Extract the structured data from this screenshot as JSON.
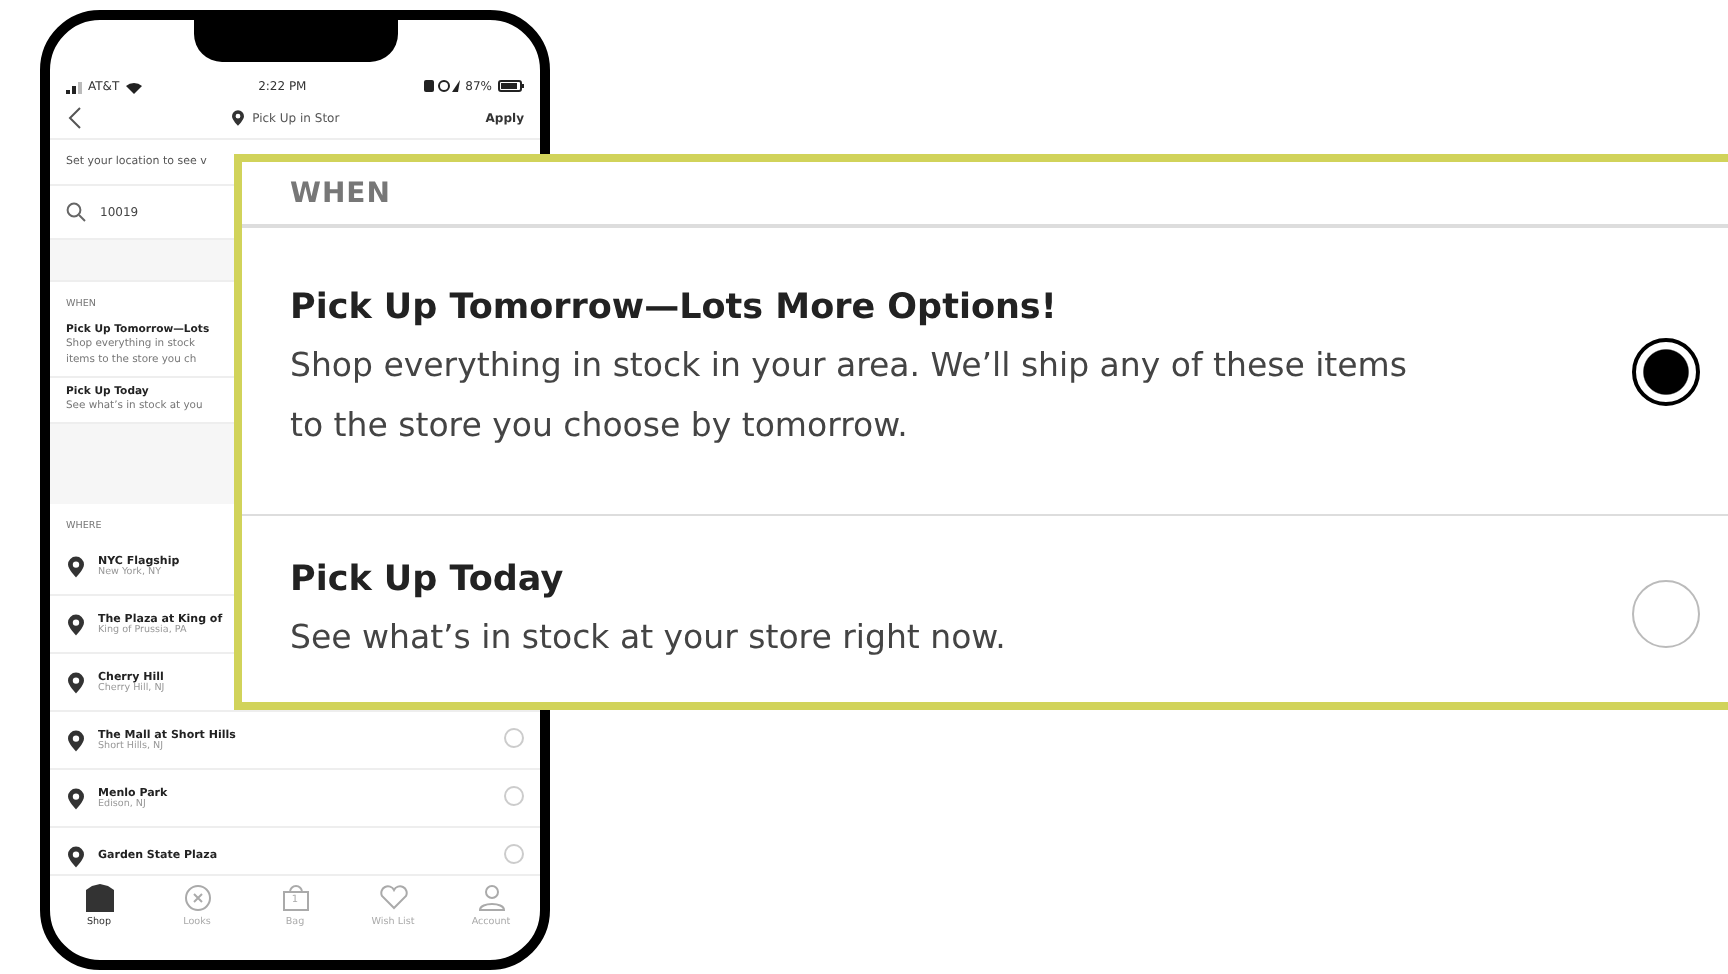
{
  "status_bar": {
    "carrier": "AT&T",
    "time": "2:22 PM",
    "battery": "87%"
  },
  "nav": {
    "title": "Pick Up in Stor",
    "action": "Apply"
  },
  "location_hint": "Set your location to see v",
  "search": {
    "value": "10019"
  },
  "when": {
    "heading": "WHEN",
    "options": [
      {
        "title": "Pick Up Tomorrow—Lots",
        "lines": [
          "Shop everything in stock",
          "items to the store you ch"
        ]
      },
      {
        "title": "Pick Up Today",
        "lines": [
          "See what’s in stock at you"
        ]
      }
    ]
  },
  "where": {
    "heading": "WHERE",
    "stores": [
      {
        "name": "NYC Flagship",
        "location": "New York, NY"
      },
      {
        "name": "The Plaza at King of",
        "location": "King of Prussia, PA"
      },
      {
        "name": "Cherry Hill",
        "location": "Cherry Hill, NJ"
      },
      {
        "name": "The Mall at Short Hills",
        "location": "Short Hills, NJ",
        "selected": false
      },
      {
        "name": "Menlo Park",
        "location": "Edison, NJ",
        "selected": false
      },
      {
        "name": "Garden State Plaza",
        "selected": false
      }
    ]
  },
  "tabs": [
    {
      "label": "Shop",
      "kind": "shop",
      "selected": true
    },
    {
      "label": "Looks",
      "kind": "looks",
      "selected": false
    },
    {
      "label": "Bag",
      "kind": "bag",
      "badge": "1",
      "selected": false
    },
    {
      "label": "Wish List",
      "kind": "wish",
      "selected": false
    },
    {
      "label": "Account",
      "kind": "account",
      "selected": false
    }
  ],
  "callout": {
    "heading": "WHEN",
    "options": [
      {
        "title": "Pick Up Tomorrow—Lots More Options!",
        "description": "Shop everything in stock in your area. We’ll ship any of these items to the store you choose by tomorrow.",
        "selected": true
      },
      {
        "title": "Pick Up Today",
        "description": "See what’s in stock at your store right now.",
        "selected": false
      }
    ]
  }
}
